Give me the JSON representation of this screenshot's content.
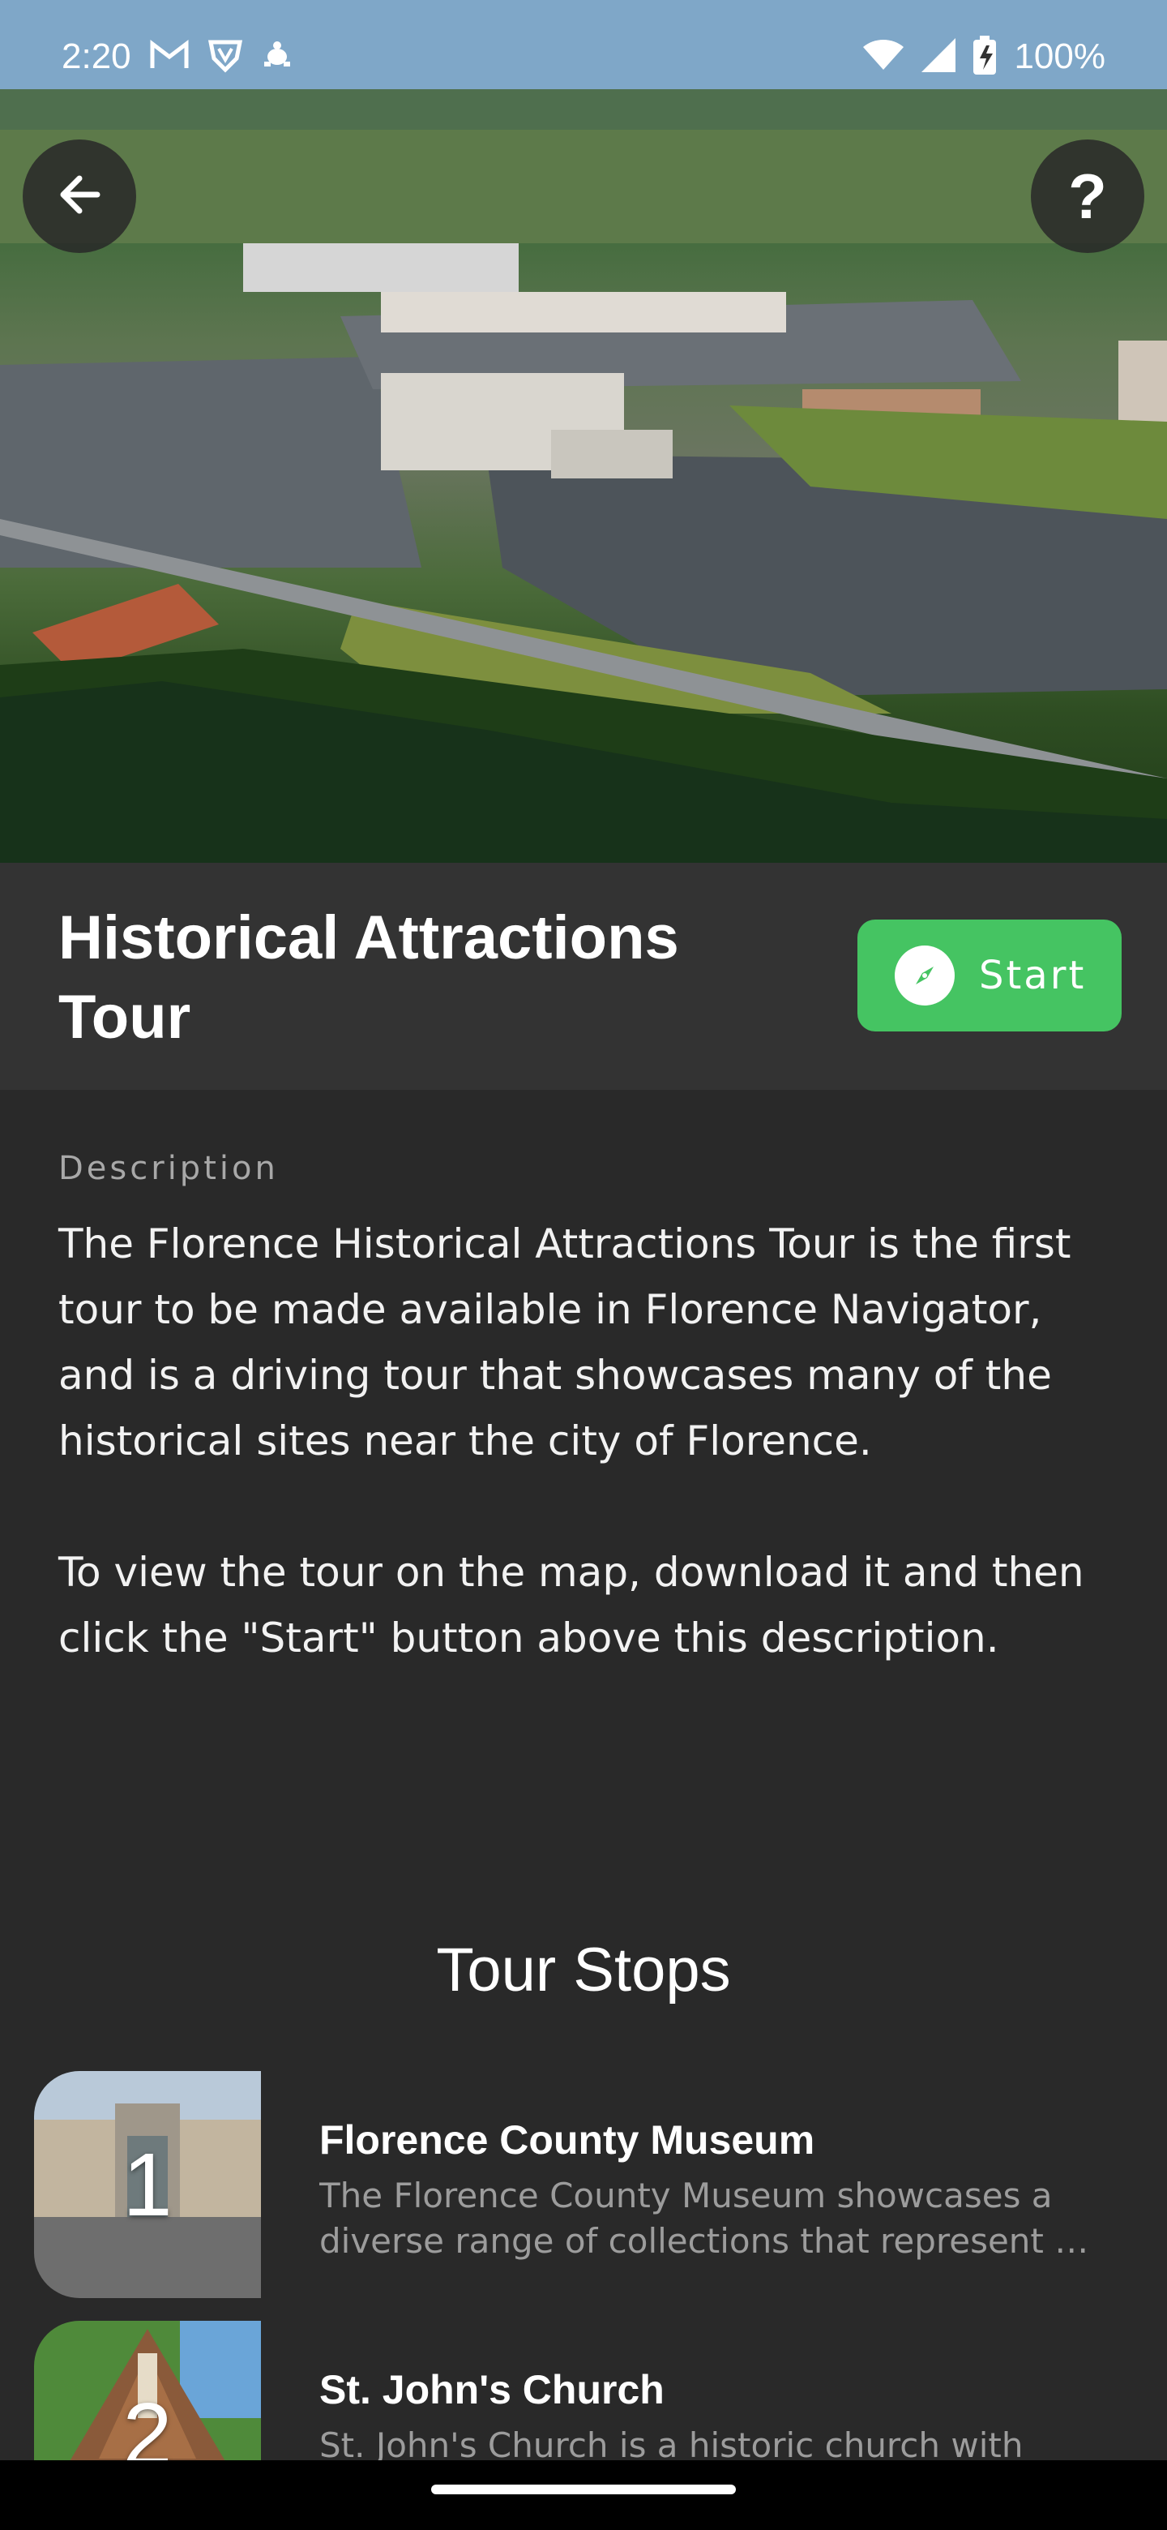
{
  "status_bar": {
    "time": "2:20",
    "battery_percent": "100%",
    "icons": [
      "gmail-icon",
      "vpn-shield-icon",
      "turtle-icon",
      "wifi-icon",
      "signal-icon",
      "battery-charging-icon"
    ]
  },
  "header": {
    "back_icon": "arrow-left-icon",
    "help_label": "?"
  },
  "tour": {
    "title": "Historical Attractions Tour",
    "start_label": "Start",
    "start_icon": "compass-icon",
    "start_color": "#45c462"
  },
  "description": {
    "heading": "Description",
    "text": "The Florence Historical Attractions Tour is the first tour to be made available in Florence Navigator, and is a driving tour that showcases many of the historical sites near the city of Florence.\n\nTo view the tour on the map, download it and then click the \"Start\" button above this description."
  },
  "stops": {
    "heading": "Tour Stops",
    "items": [
      {
        "number": "1",
        "title": "Florence County Museum",
        "description": "The Florence County Museum showcases a diverse range of collections that represent …"
      },
      {
        "number": "2",
        "title": "St. John's Church",
        "description": "St. John's Church is a historic church with"
      }
    ]
  }
}
